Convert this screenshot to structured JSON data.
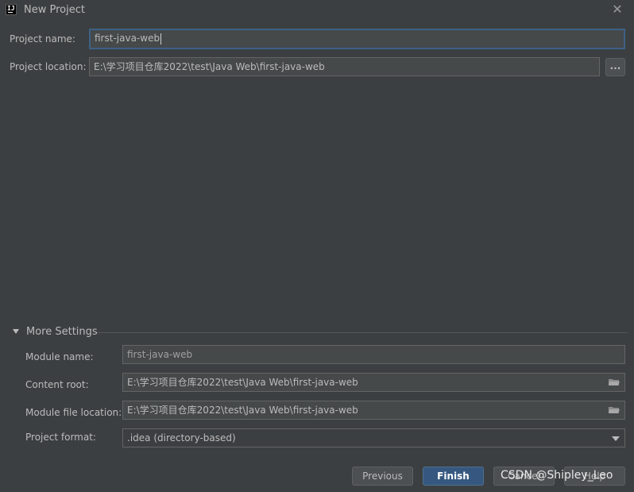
{
  "window": {
    "title": "New Project",
    "app_icon_text": "IJ",
    "close_glyph": "✕"
  },
  "form": {
    "project_name_label": "Project name:",
    "project_name_value": "first-java-web",
    "project_location_label": "Project location:",
    "project_location_value": "E:\\学习项目仓库2022\\test\\Java Web\\first-java-web",
    "browse_label": "..."
  },
  "more_settings": {
    "title": "More Settings",
    "expanded": true,
    "module_name_label": "Module name:",
    "module_name_value": "first-java-web",
    "content_root_label": "Content root:",
    "content_root_value": "E:\\学习项目仓库2022\\test\\Java Web\\first-java-web",
    "module_file_location_label": "Module file location:",
    "module_file_location_value": "E:\\学习项目仓库2022\\test\\Java Web\\first-java-web",
    "project_format_label": "Project format:",
    "project_format_value": ".idea (directory-based)"
  },
  "buttons": {
    "previous": "Previous",
    "finish": "Finish",
    "cancel": "Cancel",
    "help": "Help"
  },
  "watermark": "CSDN @Shipley_Leo",
  "colors": {
    "background": "#3c3f41",
    "field_bg": "#45494a",
    "focus_border": "#3d6185",
    "primary_button": "#365880",
    "text": "#bbbbbb"
  }
}
